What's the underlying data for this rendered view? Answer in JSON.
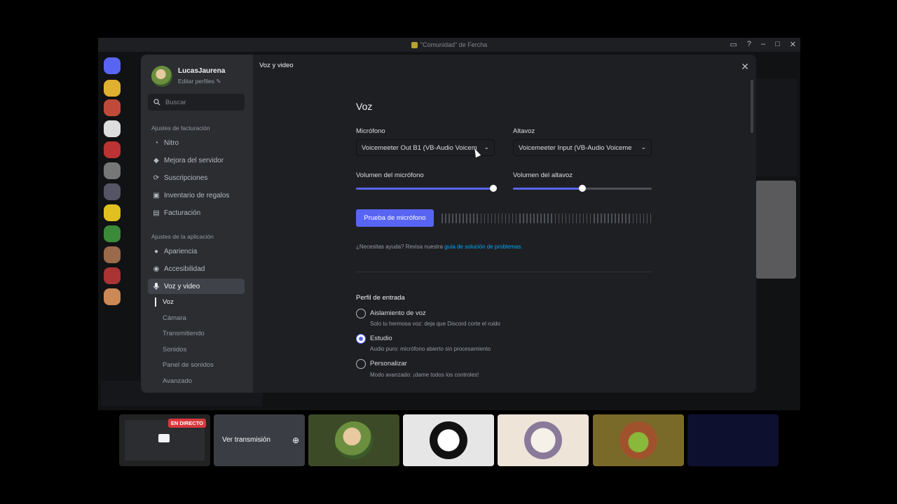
{
  "window": {
    "title": "\"Comunidad\" de Fercha"
  },
  "user": {
    "name": "LucasJaurena",
    "edit_profiles": "Editar perfiles"
  },
  "search": {
    "placeholder": "Buscar"
  },
  "sidebar": {
    "billing_header": "Ajustes de facturación",
    "billing_items": [
      {
        "label": "Nitro",
        "icon": "nitro-icon"
      },
      {
        "label": "Mejora del servidor",
        "icon": "boost-icon"
      },
      {
        "label": "Suscripciones",
        "icon": "subscriptions-icon"
      },
      {
        "label": "Inventario de regalos",
        "icon": "gift-icon"
      },
      {
        "label": "Facturación",
        "icon": "billing-icon"
      }
    ],
    "app_header": "Ajustes de la aplicación",
    "app_items": [
      {
        "label": "Apariencia",
        "icon": "palette-icon"
      },
      {
        "label": "Accesibilidad",
        "icon": "accessibility-icon"
      },
      {
        "label": "Voz y video",
        "icon": "microphone-icon",
        "active": true
      }
    ],
    "sub_items": [
      "Voz",
      "Cámara",
      "Transmitiendo",
      "Sonidos",
      "Panel de sonidos",
      "Avanzado"
    ]
  },
  "content": {
    "breadcrumb": "Voz y video",
    "section_title": "Voz",
    "microphone_label": "Micrófono",
    "microphone_value": "Voicemeeter Out B1 (VB-Audio Voicem",
    "speaker_label": "Altavoz",
    "speaker_value": "Voicemeeter Input (VB-Audio Voiceme",
    "mic_volume_label": "Volumen del micrófono",
    "mic_volume_pct": 99,
    "speaker_volume_label": "Volumen del altavoz",
    "speaker_volume_pct": 50,
    "test_button": "Prueba de micrófono",
    "help_text": "¿Necesitas ayuda? Revisa nuestra",
    "help_link": "guía de solución de problemas.",
    "input_profile_title": "Perfil de entrada",
    "profiles": [
      {
        "title": "Aislamiento de voz",
        "desc": "Solo tu hermosa voz: deja que Discord corte el ruido",
        "selected": false
      },
      {
        "title": "Estudio",
        "desc": "Audio puro: micrófono abierto sin procesamiento",
        "selected": true
      },
      {
        "title": "Personalizar",
        "desc": "Modo avanzado: ¡dame todos los controles!",
        "selected": false
      }
    ]
  },
  "stream": {
    "live_badge": "EN DIRECTO",
    "watch_label": "Ver transmisión"
  },
  "colors": {
    "accent": "#5865f2",
    "live": "#da373c",
    "link": "#00a8fc"
  }
}
